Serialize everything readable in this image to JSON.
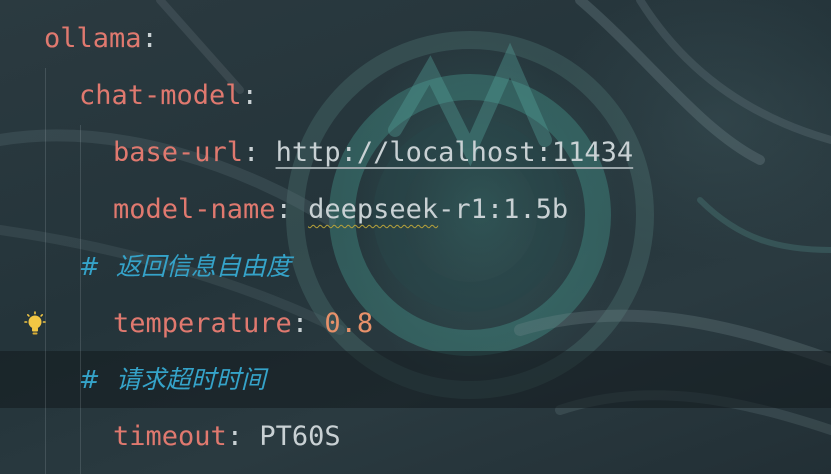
{
  "lines": [
    {
      "key": "ollama",
      "colon": ":"
    },
    {
      "key": "chat-model",
      "colon": ":"
    },
    {
      "key": "base-url",
      "colon": ": ",
      "value": "http://localhost:11434"
    },
    {
      "key": "model-name",
      "colon": ": ",
      "value_prefix": "deepseek",
      "value_suffix": "-r1:1.5b"
    },
    {
      "comment_hash": "#",
      "comment_text": "返回信息自由度"
    },
    {
      "key": "temperature",
      "colon": ": ",
      "value": "0.8"
    },
    {
      "comment_hash": "#",
      "comment_text": "请求超时时间"
    },
    {
      "key": "timeout",
      "colon": ": ",
      "value": "PT60S"
    }
  ],
  "icons": {
    "gutter": "lightbulb-icon"
  },
  "colors": {
    "key": "#e0796f",
    "comment": "#35a3c9",
    "number": "#e8916a",
    "text": "#c9d1d4",
    "lightbulb": "#f2c744"
  }
}
